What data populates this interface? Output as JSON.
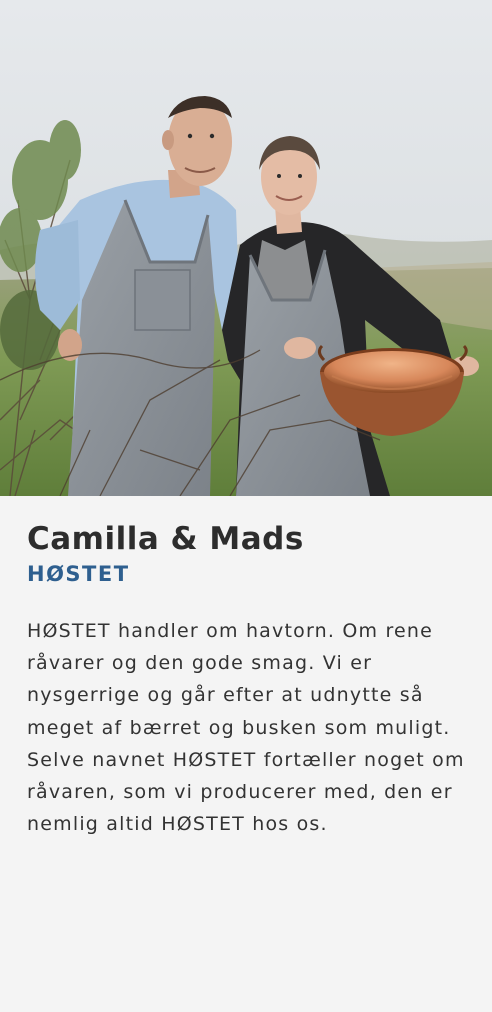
{
  "card": {
    "photo_alt": "Camilla og Mads med havtorn",
    "name": "Camilla & Mads",
    "brand": "HØSTET",
    "description": "HØSTET handler om havtorn. Om rene råvarer og den gode smag. Vi er nysgerrige og går efter at udnytte så meget af bærret og busken som muligt. Selve navnet HØSTET fortæller noget om råvaren, som vi producerer med, den er nemlig altid HØSTET hos os."
  },
  "colors": {
    "background": "#f4f4f4",
    "name_text": "#2d2d2d",
    "brand_accent": "#2e5f8f",
    "body_text": "#333333"
  }
}
